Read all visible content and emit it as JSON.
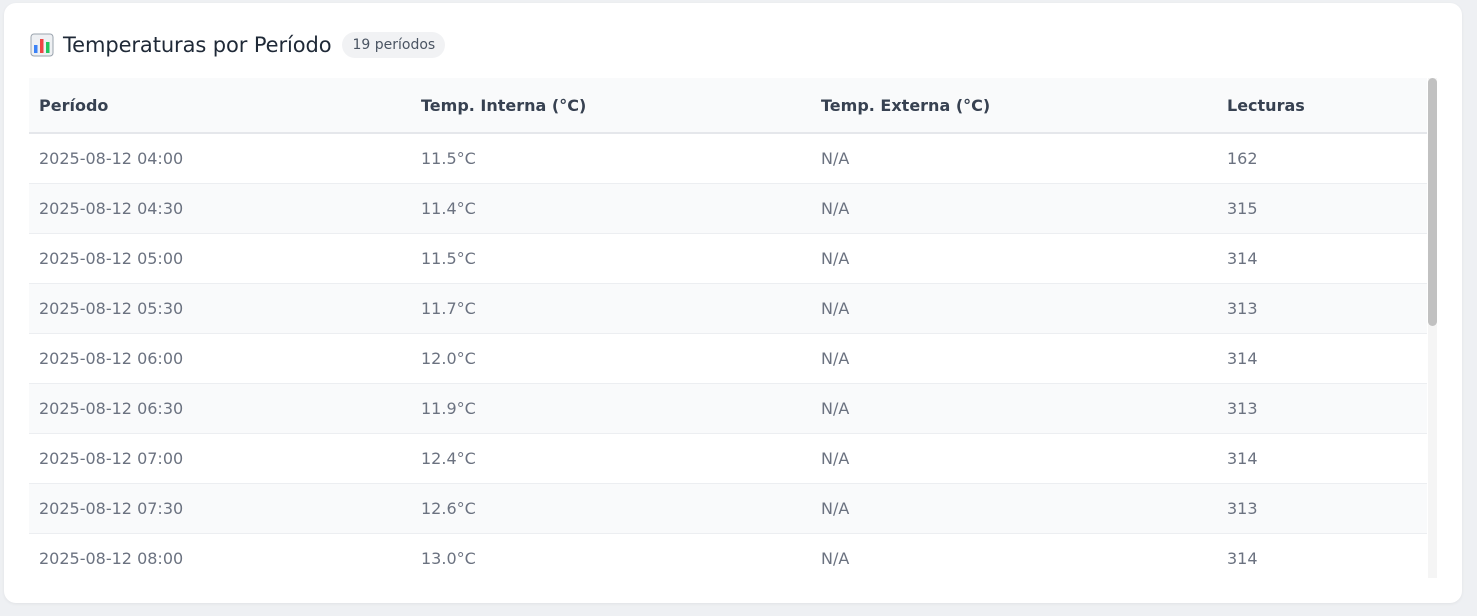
{
  "header": {
    "title": "Temperaturas por Período",
    "badge": "19 períodos",
    "icon": "bar-chart-icon"
  },
  "table": {
    "columns": [
      "Período",
      "Temp. Interna (°C)",
      "Temp. Externa (°C)",
      "Lecturas"
    ],
    "rows": [
      [
        "2025-08-12 04:00",
        "11.5°C",
        "N/A",
        "162"
      ],
      [
        "2025-08-12 04:30",
        "11.4°C",
        "N/A",
        "315"
      ],
      [
        "2025-08-12 05:00",
        "11.5°C",
        "N/A",
        "314"
      ],
      [
        "2025-08-12 05:30",
        "11.7°C",
        "N/A",
        "313"
      ],
      [
        "2025-08-12 06:00",
        "12.0°C",
        "N/A",
        "314"
      ],
      [
        "2025-08-12 06:30",
        "11.9°C",
        "N/A",
        "313"
      ],
      [
        "2025-08-12 07:00",
        "12.4°C",
        "N/A",
        "314"
      ],
      [
        "2025-08-12 07:30",
        "12.6°C",
        "N/A",
        "313"
      ],
      [
        "2025-08-12 08:00",
        "13.0°C",
        "N/A",
        "314"
      ]
    ]
  }
}
